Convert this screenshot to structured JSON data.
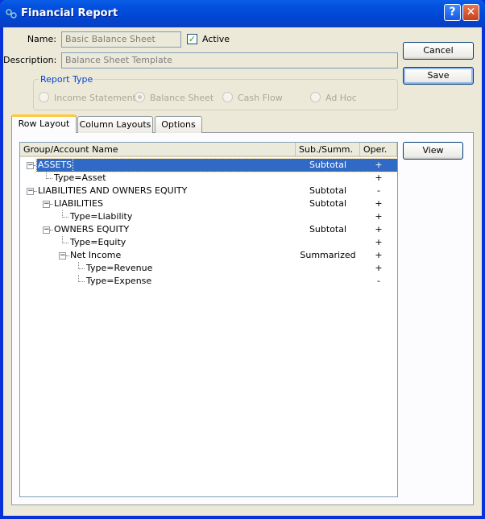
{
  "window": {
    "title": "Financial Report",
    "icon": "app-gears-icon",
    "help_label": "?",
    "close_label": "✕"
  },
  "form": {
    "name_label": "Name:",
    "name_value": "Basic Balance Sheet",
    "active_label": "Active",
    "active_checked": true,
    "description_label": "Description:",
    "description_value": "Balance Sheet Template",
    "report_type": {
      "legend": "Report Type",
      "options": [
        "Income Statement",
        "Balance Sheet",
        "Cash Flow",
        "Ad Hoc"
      ],
      "selected": "Balance Sheet"
    }
  },
  "buttons": {
    "cancel": "Cancel",
    "save": "Save",
    "view": "View"
  },
  "tabs": [
    {
      "label": "Row Layout",
      "selected": true
    },
    {
      "label": "Column Layouts"
    },
    {
      "label": "Options"
    }
  ],
  "table": {
    "columns": [
      "Group/Account Name",
      "Sub./Summ.",
      "Oper."
    ],
    "rows": [
      {
        "name": "ASSETS",
        "level": 0,
        "expandable": true,
        "summ": "Subtotal",
        "oper": "+",
        "selected": true
      },
      {
        "name": "Type=Asset",
        "level": 1,
        "expandable": false,
        "summ": "",
        "oper": "+"
      },
      {
        "name": "LIABILITIES AND OWNERS EQUITY",
        "level": 0,
        "expandable": true,
        "summ": "Subtotal",
        "oper": "-"
      },
      {
        "name": "LIABILITIES",
        "level": 1,
        "expandable": true,
        "summ": "Subtotal",
        "oper": "+"
      },
      {
        "name": "Type=Liability",
        "level": 2,
        "expandable": false,
        "summ": "",
        "oper": "+"
      },
      {
        "name": "OWNERS EQUITY",
        "level": 1,
        "expandable": true,
        "summ": "Subtotal",
        "oper": "+"
      },
      {
        "name": "Type=Equity",
        "level": 2,
        "expandable": false,
        "summ": "",
        "oper": "+"
      },
      {
        "name": "Net Income",
        "level": 2,
        "expandable": true,
        "summ": "Summarized",
        "oper": "+"
      },
      {
        "name": "Type=Revenue",
        "level": 3,
        "expandable": false,
        "summ": "",
        "oper": "+"
      },
      {
        "name": "Type=Expense",
        "level": 3,
        "expandable": false,
        "summ": "",
        "oper": "-"
      }
    ]
  },
  "colors": {
    "title_bar": "#0054e3",
    "selection": "#316ac5",
    "dialog_bg": "#ece9d8",
    "legend": "#0046d5"
  }
}
